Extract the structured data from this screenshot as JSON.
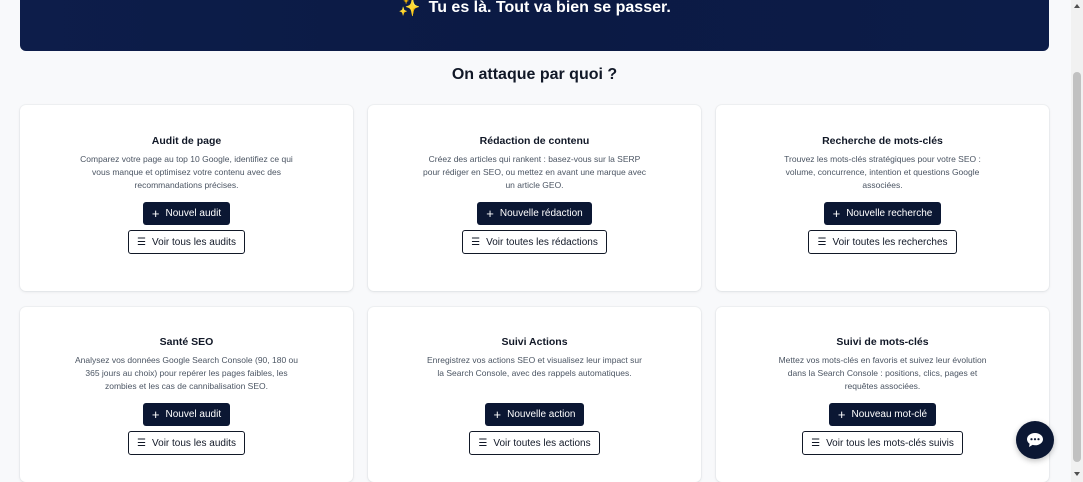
{
  "hero": {
    "sparkle": "✨",
    "text": "Tu es là. Tout va bien se passer."
  },
  "section_title": "On attaque par quoi ?",
  "cards": [
    {
      "title": "Audit de page",
      "desc": "Comparez votre page au top 10 Google, identifiez ce qui vous manque et optimisez votre contenu avec des recommandations précises.",
      "primary": "Nouvel audit",
      "secondary": "Voir tous les audits"
    },
    {
      "title": "Rédaction de contenu",
      "desc": "Créez des articles qui rankent : basez-vous sur la SERP pour rédiger en SEO, ou mettez en avant une marque avec un article GEO.",
      "primary": "Nouvelle rédaction",
      "secondary": "Voir toutes les rédactions"
    },
    {
      "title": "Recherche de mots-clés",
      "desc": "Trouvez les mots-clés stratégiques pour votre SEO : volume, concurrence, intention et questions Google associées.",
      "primary": "Nouvelle recherche",
      "secondary": "Voir toutes les recherches"
    },
    {
      "title": "Santé SEO",
      "desc": "Analysez vos données Google Search Console (90, 180 ou 365 jours au choix) pour repérer les pages faibles, les zombies et les cas de cannibalisation SEO.",
      "primary": "Nouvel audit",
      "secondary": "Voir tous les audits"
    },
    {
      "title": "Suivi Actions",
      "desc": "Enregistrez vos actions SEO et visualisez leur impact sur la Search Console, avec des rappels automatiques.",
      "primary": "Nouvelle action",
      "secondary": "Voir toutes les actions"
    },
    {
      "title": "Suivi de mots-clés",
      "desc": "Mettez vos mots-clés en favoris et suivez leur évolution dans la Search Console : positions, clics, pages et requêtes associées.",
      "primary": "Nouveau mot-clé",
      "secondary": "Voir tous les mots-clés suivis"
    }
  ],
  "icons": {
    "primary": "plus-icon",
    "secondary": "list-icon",
    "chat": "chat-bubble-icon"
  },
  "colors": {
    "hero_bg": "#0d1d4a",
    "primary_button": "#0b1733",
    "page_bg": "#f8f9fb"
  }
}
